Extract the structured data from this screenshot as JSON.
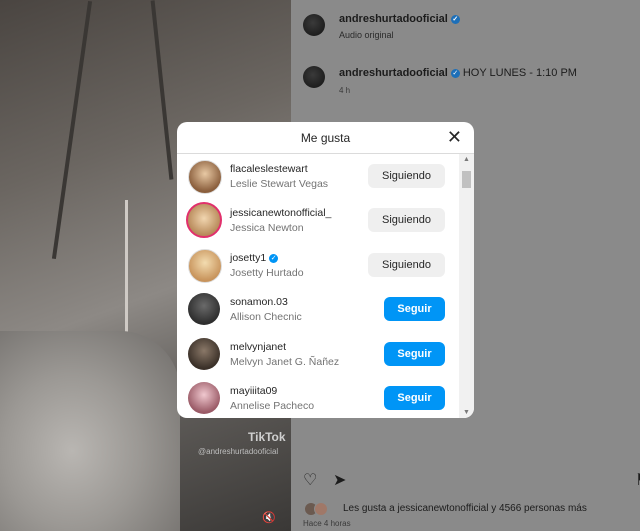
{
  "post": {
    "author": "andreshurtadooficial",
    "audio": "Audio original",
    "comment_author": "andreshurtadooficial",
    "comment_text": "HOY LUNES - 1:10 PM",
    "comment_time": "4 h",
    "likes_text": "Les gusta a jessicanewtonofficial  y 4566 personas más",
    "post_time": "Hace 4 horas",
    "watermark": "TikTok",
    "watermark_handle": "@andreshurtadooficial"
  },
  "modal": {
    "title": "Me gusta",
    "users": [
      {
        "username": "flacaleslestewart",
        "fullname": "Leslie Stewart Vegas",
        "verified": false,
        "button": "Siguiendo",
        "avatar_color": "#c9a27a"
      },
      {
        "username": "jessicanewtonofficial_",
        "fullname": "Jessica Newton",
        "verified": false,
        "button": "Siguiendo",
        "avatar_color": "#d8b48a"
      },
      {
        "username": "josetty1",
        "fullname": "Josetty Hurtado",
        "verified": true,
        "button": "Siguiendo",
        "avatar_color": "#e2c08f"
      },
      {
        "username": "sonamon.03",
        "fullname": "Allison Checnic",
        "verified": false,
        "button": "Seguir",
        "avatar_color": "#4a4a4a"
      },
      {
        "username": "melvynjanet",
        "fullname": "Melvyn Janet G. Ñañez",
        "verified": false,
        "button": "Seguir",
        "avatar_color": "#5a4c40"
      },
      {
        "username": "mayiiita09",
        "fullname": "Annelise Pacheco",
        "verified": false,
        "button": "Seguir",
        "avatar_color": "#b07a86"
      }
    ]
  },
  "colors": {
    "follow_blue": "#0095f6",
    "following_gray": "#efefef",
    "verified_blue": "#1d6fb8"
  },
  "icons": {
    "close": "close-icon",
    "like": "heart-icon",
    "share": "send-icon",
    "save": "bookmark-icon",
    "mute": "speaker-muted-icon"
  }
}
